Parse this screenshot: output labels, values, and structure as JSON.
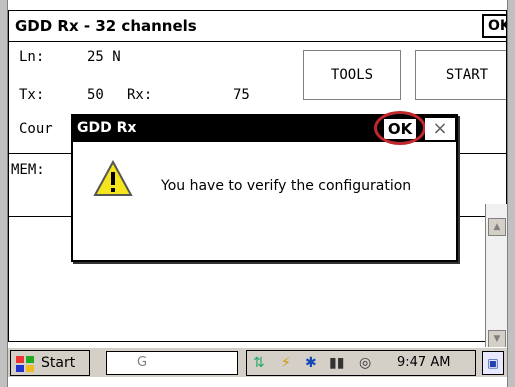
{
  "app": {
    "title": "GDD Rx - 32 channels",
    "title_ok": "OK"
  },
  "fields": {
    "ln_label": "Ln:",
    "ln_value": "25 N",
    "tx_label": "Tx:",
    "tx_value": "50",
    "rx_label": "Rx:",
    "rx_value": "75",
    "count_label": "Cour",
    "mem_label": "MEM:"
  },
  "buttons": {
    "tools": "TOOLS",
    "start": "START"
  },
  "dialog": {
    "title": "GDD Rx",
    "ok": "OK",
    "close": "×",
    "message": "You have to verify the configuration",
    "icon": "warning-icon",
    "highlight_color": "#c0282d"
  },
  "taskbar": {
    "start_label": "Start",
    "window_label": "G",
    "time": "9:47 AM",
    "tray_icons": [
      "network-icon",
      "power-icon",
      "bluetooth-icon",
      "wifi-icon",
      "signal-icon"
    ]
  }
}
